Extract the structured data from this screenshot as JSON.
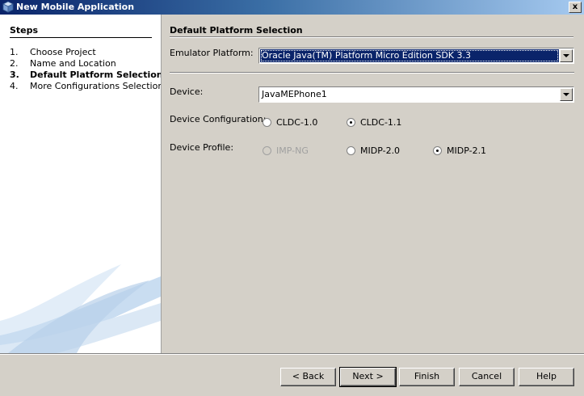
{
  "window": {
    "title": "New Mobile Application",
    "close_label": "x"
  },
  "steps": {
    "heading": "Steps",
    "items": [
      {
        "num": "1.",
        "label": "Choose Project",
        "current": false
      },
      {
        "num": "2.",
        "label": "Name and Location",
        "current": false
      },
      {
        "num": "3.",
        "label": "Default Platform Selection",
        "current": true
      },
      {
        "num": "4.",
        "label": "More Configurations Selection",
        "current": false
      }
    ]
  },
  "main": {
    "title": "Default Platform Selection",
    "emulator_platform": {
      "label": "Emulator Platform:",
      "value": "Oracle Java(TM) Platform Micro Edition SDK 3.3"
    },
    "device": {
      "label": "Device:",
      "value": "JavaMEPhone1"
    },
    "device_configuration": {
      "label": "Device Configuration:",
      "options": [
        {
          "label": "CLDC-1.0",
          "selected": false,
          "enabled": true
        },
        {
          "label": "CLDC-1.1",
          "selected": true,
          "enabled": true
        }
      ]
    },
    "device_profile": {
      "label": "Device Profile:",
      "options": [
        {
          "label": "IMP-NG",
          "selected": false,
          "enabled": false
        },
        {
          "label": "MIDP-2.0",
          "selected": false,
          "enabled": true
        },
        {
          "label": "MIDP-2.1",
          "selected": true,
          "enabled": true
        }
      ]
    }
  },
  "buttons": {
    "back": "< Back",
    "next": "Next >",
    "finish": "Finish",
    "cancel": "Cancel",
    "help": "Help"
  },
  "colors": {
    "titlebar_start": "#0a246a",
    "titlebar_end": "#a6caf0",
    "selection": "#0a246a",
    "dialog_bg": "#d4d0c8",
    "swoosh": "#c6dcf0"
  },
  "icons": {
    "app": "cube-icon",
    "close": "close-icon",
    "dropdown": "chevron-down-icon"
  }
}
